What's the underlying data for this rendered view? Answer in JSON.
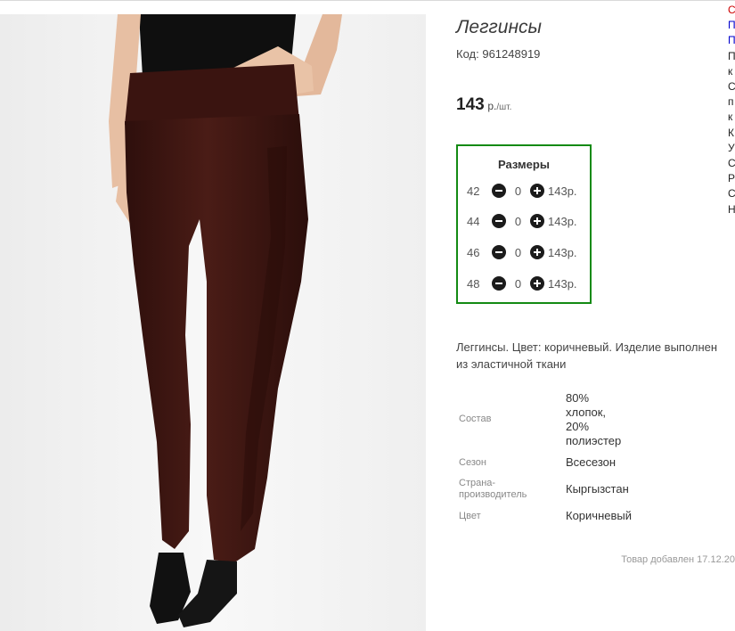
{
  "product": {
    "title": "Леггинсы",
    "sku_label": "Код:",
    "sku": "961248919",
    "price": "143",
    "price_unit": "р.",
    "price_per": "/шт."
  },
  "sizes": {
    "title": "Размеры",
    "rows": [
      {
        "size": "42",
        "qty": "0",
        "price": "143р."
      },
      {
        "size": "44",
        "qty": "0",
        "price": "143р."
      },
      {
        "size": "46",
        "qty": "0",
        "price": "143р."
      },
      {
        "size": "48",
        "qty": "0",
        "price": "143р."
      }
    ]
  },
  "description": {
    "line1": "Леггинсы. Цвет: коричневый. Изделие выполнен",
    "line2": "из эластичной ткани"
  },
  "specs": [
    {
      "label": "Состав",
      "value_lines": [
        "80%",
        "хлопок,",
        "20%",
        "полиэстер"
      ]
    },
    {
      "label": "Сезон",
      "value_lines": [
        "Всесезон"
      ]
    },
    {
      "label_lines": [
        "Страна-",
        "производитель"
      ],
      "value_lines": [
        "Кыргызстан"
      ]
    },
    {
      "label": "Цвет",
      "value_lines": [
        "Коричневый"
      ]
    }
  ],
  "added": "Товар добавлен 17.12.20",
  "right_menu": [
    {
      "text": "С",
      "color": "#cc0000"
    },
    {
      "text": "П",
      "color": "#0000cc"
    },
    {
      "text": "П",
      "color": "#0000cc"
    },
    {
      "text": "П"
    },
    {
      "text": "к"
    },
    {
      "text": "С"
    },
    {
      "text": "п"
    },
    {
      "text": "к"
    },
    {
      "text": "К"
    },
    {
      "text": "У"
    },
    {
      "text": "С"
    },
    {
      "text": "Р"
    },
    {
      "text": "С"
    },
    {
      "text": "Н"
    }
  ],
  "colors": {
    "size_box_border": "#138a13",
    "leggings": "#3d1612",
    "accent_red": "#cc0000",
    "link_blue": "#0000cc"
  }
}
